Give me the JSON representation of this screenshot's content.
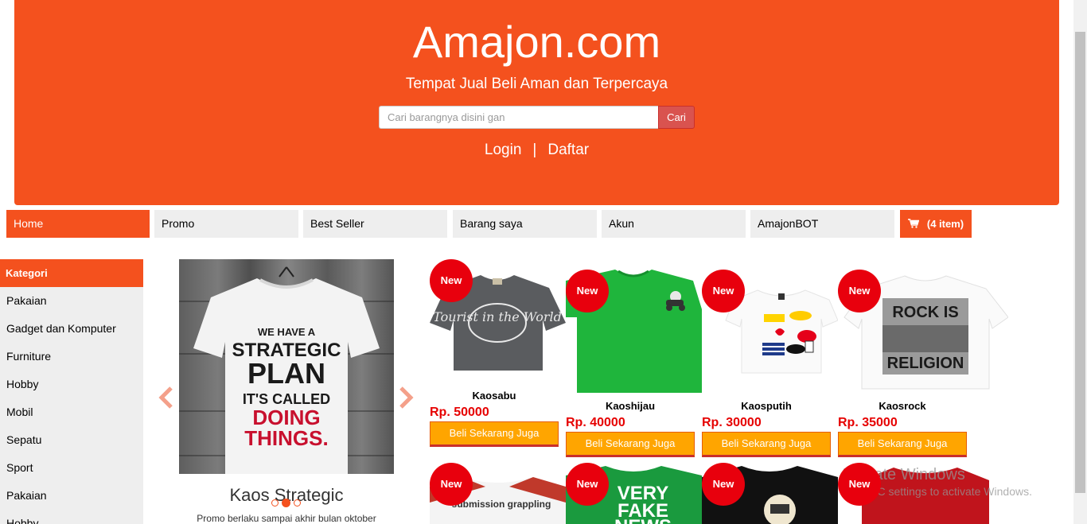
{
  "header": {
    "title": "Amajon.com",
    "tagline": "Tempat Jual Beli Aman dan Terpercaya",
    "search_placeholder": "Cari barangnya disini gan",
    "search_button": "Cari",
    "login": "Login",
    "separator": "|",
    "register": "Daftar",
    "bg_color": "#f4511e"
  },
  "nav": {
    "items": [
      "Home",
      "Promo",
      "Best Seller",
      "Barang saya",
      "Akun",
      "AmajonBOT"
    ],
    "cart_label": "(4 item)",
    "cart_icon": "cart-icon"
  },
  "sidebar": {
    "heading": "Kategori",
    "items": [
      "Pakaian",
      "Gadget dan Komputer",
      "Furniture",
      "Hobby",
      "Mobil",
      "Sepatu",
      "Sport",
      "Pakaian",
      "Hobby"
    ]
  },
  "carousel": {
    "shirt_lines": [
      "WE HAVE A",
      "STRATEGIC",
      "PLAN",
      "IT'S CALLED",
      "DOING",
      "THINGS."
    ],
    "caption": "Kaos Strategic",
    "subcaption": "Promo berlaku sampai akhir bulan oktober",
    "prev_icon": "chevron-left-icon",
    "next_icon": "chevron-right-icon"
  },
  "products": [
    {
      "badge": "New",
      "name": "Kaosabu",
      "price": "Rp. 50000",
      "button": "Beli Sekarang Juga",
      "graphic": "Tourist in the World"
    },
    {
      "badge": "New",
      "name": "Kaoshijau",
      "price": "Rp. 40000",
      "button": "Beli Sekarang Juga"
    },
    {
      "badge": "New",
      "name": "Kaosputih",
      "price": "Rp. 30000",
      "button": "Beli Sekarang Juga"
    },
    {
      "badge": "New",
      "name": "Kaosrock",
      "price": "Rp. 35000",
      "button": "Beli Sekarang Juga",
      "graphic": [
        "ROCK IS",
        "RELIGION"
      ]
    }
  ],
  "products_row2": [
    {
      "badge": "New",
      "graphic": "submission grappling"
    },
    {
      "badge": "New",
      "graphic": [
        "VERY",
        "FAKE",
        "NEWS"
      ]
    },
    {
      "badge": "New"
    },
    {
      "badge": "New"
    }
  ],
  "watermark": {
    "title": "Activate Windows",
    "subtitle": "Go to PC settings to activate Windows."
  }
}
